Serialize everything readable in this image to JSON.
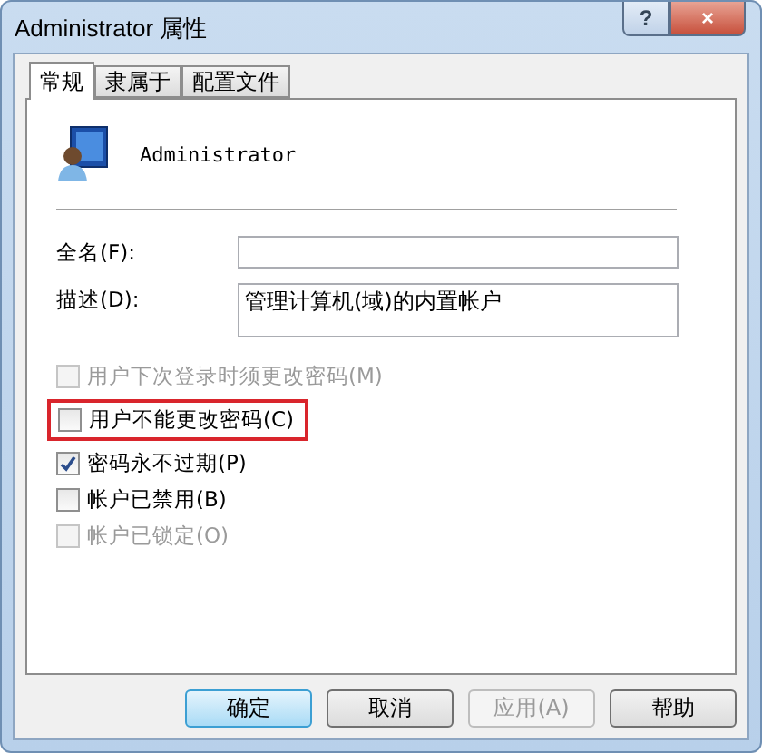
{
  "window": {
    "title": "Administrator 属性",
    "help_button": "?",
    "close_button": "×"
  },
  "tabs": [
    {
      "label": "常规",
      "selected": true
    },
    {
      "label": "隶属于",
      "selected": false
    },
    {
      "label": "配置文件",
      "selected": false
    }
  ],
  "user": {
    "name": "Administrator"
  },
  "fields": [
    {
      "label": "全名(F):",
      "kind": "line"
    },
    {
      "label": "描述(D):",
      "value": "管理计算机(域)的内置帐户",
      "kind": "area"
    }
  ],
  "options": [
    {
      "label": "用户下次登录时须更改密码(M)",
      "checked": false,
      "disabled": true,
      "highlighted": false
    },
    {
      "label": "用户不能更改密码(C)",
      "checked": false,
      "disabled": false,
      "highlighted": true
    },
    {
      "label": "密码永不过期(P)",
      "checked": true,
      "disabled": false,
      "highlighted": false
    },
    {
      "label": "帐户已禁用(B)",
      "checked": false,
      "disabled": false,
      "highlighted": false
    },
    {
      "label": "帐户已锁定(O)",
      "checked": false,
      "disabled": true,
      "highlighted": false
    }
  ],
  "buttons": [
    {
      "label": "确定",
      "kind": "default",
      "disabled": false
    },
    {
      "label": "取消",
      "kind": "normal",
      "disabled": false
    },
    {
      "label": "应用(A)",
      "kind": "normal",
      "disabled": true
    },
    {
      "label": "帮助",
      "kind": "normal",
      "disabled": false
    }
  ]
}
